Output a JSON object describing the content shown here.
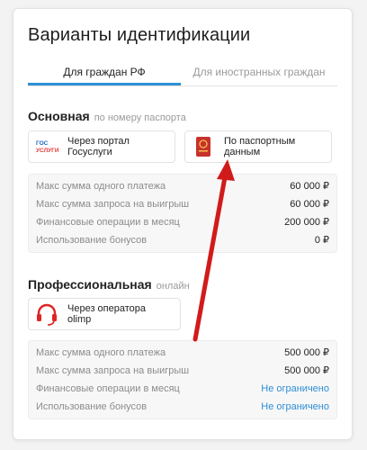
{
  "title": "Варианты идентификации",
  "tabs": [
    {
      "label": "Для граждан РФ",
      "active": true
    },
    {
      "label": "Для иностранных граждан",
      "active": false
    }
  ],
  "basic": {
    "title": "Основная",
    "subtitle": "по номеру паспорта",
    "methods": [
      {
        "label": "Через портал\nГосуслуги",
        "icon": "gosuslugi-logo",
        "logo_text": "ГОС\nУСЛУГИ"
      },
      {
        "label": "По паспортным\nданным",
        "icon": "passport-icon"
      }
    ],
    "limits": [
      {
        "label": "Макс сумма одного платежа",
        "value": "60 000 ₽"
      },
      {
        "label": "Макс сумма запроса на выигрыш",
        "value": "60 000 ₽"
      },
      {
        "label": "Финансовые операции в месяц",
        "value": "200 000 ₽"
      },
      {
        "label": "Использование бонусов",
        "value": "0 ₽"
      }
    ]
  },
  "pro": {
    "title": "Профессиональная",
    "subtitle": "онлайн",
    "methods": [
      {
        "label": "Через оператора\nolimp",
        "icon": "headset-icon"
      }
    ],
    "limits": [
      {
        "label": "Макс сумма одного платежа",
        "value": "500 000 ₽"
      },
      {
        "label": "Макс сумма запроса на выигрыш",
        "value": "500 000 ₽"
      },
      {
        "label": "Финансовые операции в месяц",
        "value": "Не ограничено"
      },
      {
        "label": "Использование бонусов",
        "value": "Не ограничено"
      }
    ]
  },
  "colors": {
    "accent": "#2e8fd6",
    "annotation_arrow": "#d11b1b",
    "headset": "#e02424",
    "passport": "#c8312c"
  }
}
